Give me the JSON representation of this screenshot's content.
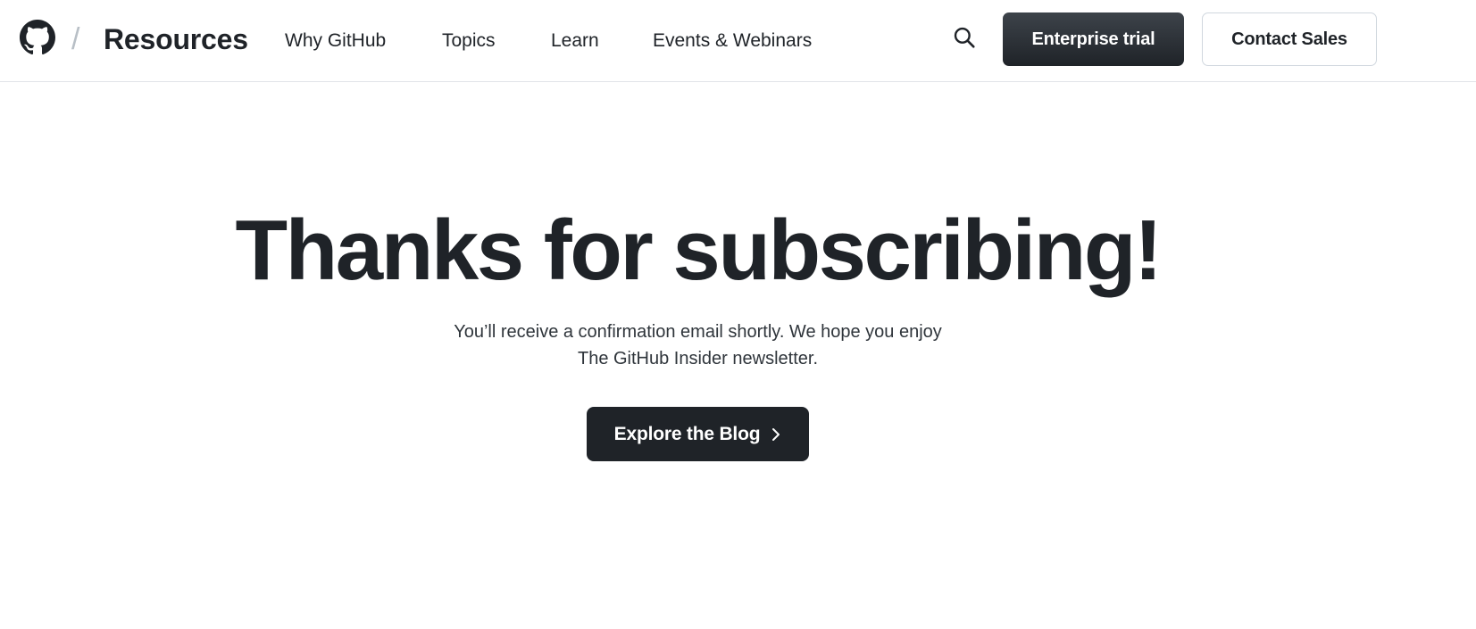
{
  "header": {
    "logo_icon": "github-mark-icon",
    "separator": "/",
    "brand": "Resources",
    "nav": [
      {
        "label": "Why GitHub"
      },
      {
        "label": "Topics"
      },
      {
        "label": "Learn"
      },
      {
        "label": "Events & Webinars"
      }
    ],
    "search_icon": "search-icon",
    "primary_button": "Enterprise trial",
    "secondary_button": "Contact Sales"
  },
  "hero": {
    "title": "Thanks for subscribing!",
    "subtitle_line1": "You’ll receive a confirmation email shortly. We hope you enjoy",
    "subtitle_line2": "The GitHub Insider newsletter.",
    "cta_label": "Explore the Blog",
    "cta_icon": "chevron-right-icon"
  },
  "colors": {
    "text": "#1f2328",
    "button_dark": "#1f2328",
    "border": "#d0d7de",
    "background": "#ffffff"
  }
}
